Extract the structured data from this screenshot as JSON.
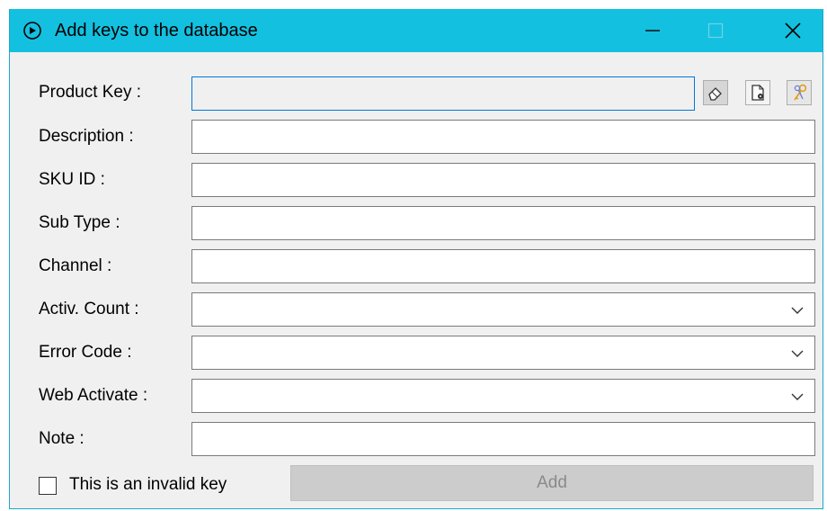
{
  "window": {
    "title": "Add keys to the database",
    "minimize_label": "—",
    "close_label": "✕"
  },
  "form": {
    "product_key": {
      "label": "Product Key :",
      "value": ""
    },
    "description": {
      "label": "Description :",
      "value": ""
    },
    "sku_id": {
      "label": "SKU ID :",
      "value": ""
    },
    "sub_type": {
      "label": "Sub Type :",
      "value": ""
    },
    "channel": {
      "label": "Channel :",
      "value": ""
    },
    "activ_count": {
      "label": "Activ. Count :",
      "value": ""
    },
    "error_code": {
      "label": "Error Code :",
      "value": ""
    },
    "web_activate": {
      "label": "Web Activate :",
      "value": ""
    },
    "note": {
      "label": "Note :",
      "value": ""
    },
    "invalid_key": {
      "label": "This is an invalid key",
      "checked": false
    },
    "add_label": "Add"
  },
  "icons": {
    "title": "add-circle-icon",
    "clear": "eraser-icon",
    "load_file": "file-load-icon",
    "get_keys": "keys-icon",
    "dropdown": "chevron-down-icon"
  },
  "colors": {
    "titlebar": "#14c0e0",
    "focus_border": "#0078d7",
    "disabled_button": "#cccccc"
  }
}
